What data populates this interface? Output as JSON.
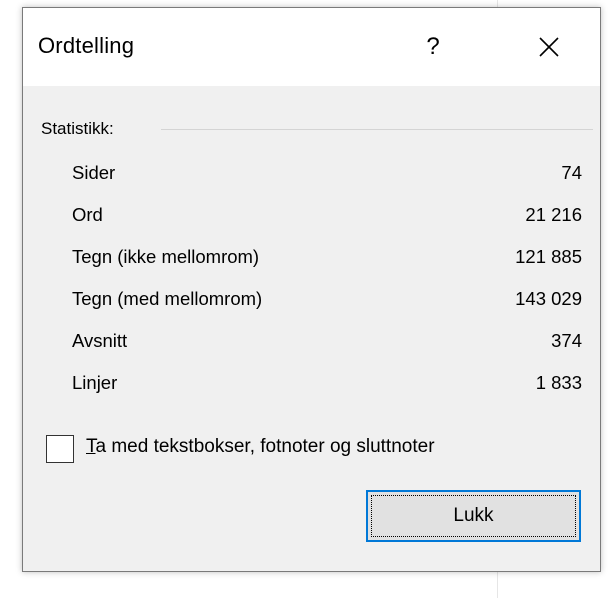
{
  "dialog": {
    "title": "Ordtelling",
    "help_glyph": "?",
    "group_label": "Statistikk:",
    "stats": [
      {
        "label": "Sider",
        "value": "74"
      },
      {
        "label": "Ord",
        "value": "21 216"
      },
      {
        "label": "Tegn (ikke mellomrom)",
        "value": "121 885"
      },
      {
        "label": "Tegn (med mellomrom)",
        "value": "143 029"
      },
      {
        "label": "Avsnitt",
        "value": "374"
      },
      {
        "label": "Linjer",
        "value": "1 833"
      }
    ],
    "checkbox": {
      "accel": "T",
      "label_rest": "a med tekstbokser, fotnoter og sluttnoter",
      "checked": false
    },
    "close_button_label": "Lukk",
    "icons": {
      "close": "close-icon",
      "help": "help-icon"
    },
    "colors": {
      "focus_border": "#0078d7",
      "dialog_bg": "#f0f0f0",
      "titlebar_bg": "#ffffff"
    }
  }
}
